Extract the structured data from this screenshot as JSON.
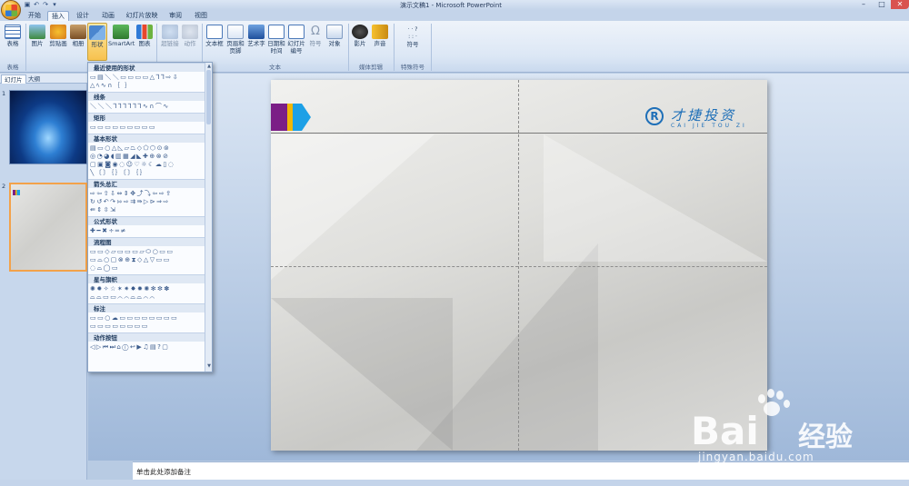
{
  "window": {
    "title": "演示文稿1 - Microsoft PowerPoint",
    "controls": [
      "–",
      "□",
      "✕"
    ]
  },
  "tabs": [
    "开始",
    "插入",
    "设计",
    "动画",
    "幻灯片放映",
    "审阅",
    "视图"
  ],
  "active_tab": "插入",
  "ribbon": {
    "buttons": [
      "表格",
      "图片",
      "剪贴画",
      "相册",
      "形状",
      "SmartArt",
      "图表",
      "超链接",
      "动作",
      "文本框",
      "页眉和页脚",
      "艺术字",
      "日期和时间",
      "幻灯片编号",
      "符号",
      "对象",
      "影片",
      "声音",
      "符号"
    ],
    "groups": [
      "表格",
      "文本",
      "媒体剪辑",
      "特殊符号"
    ]
  },
  "left_panel": {
    "tabs": [
      "幻灯片",
      "大纲"
    ],
    "slide_numbers": [
      "1",
      "2"
    ]
  },
  "shapes_menu": {
    "categories": [
      "最近使用的形状",
      "线条",
      "矩形",
      "基本形状",
      "箭头总汇",
      "公式形状",
      "流程图",
      "星与旗帜",
      "标注",
      "动作按钮"
    ]
  },
  "slide": {
    "logo_mark": "R",
    "logo_cn": "才捷投资",
    "logo_en": "CAI JIE TOU ZI"
  },
  "notes": {
    "placeholder": "单击此处添加备注"
  },
  "watermark": {
    "brand": "Bai",
    "brand_cn": "经验",
    "url": "jingyan.baidu.com"
  },
  "colors": {
    "accent_purple": "#7b1e86",
    "accent_yellow": "#f2b705",
    "accent_blue": "#1da0e6",
    "logo_blue": "#1e6fb8",
    "thumb_selected": "#f3a24a"
  },
  "icons": {
    "office_button": "office-logo-icon",
    "save": "save-icon",
    "undo": "undo-icon",
    "redo": "redo-icon"
  }
}
